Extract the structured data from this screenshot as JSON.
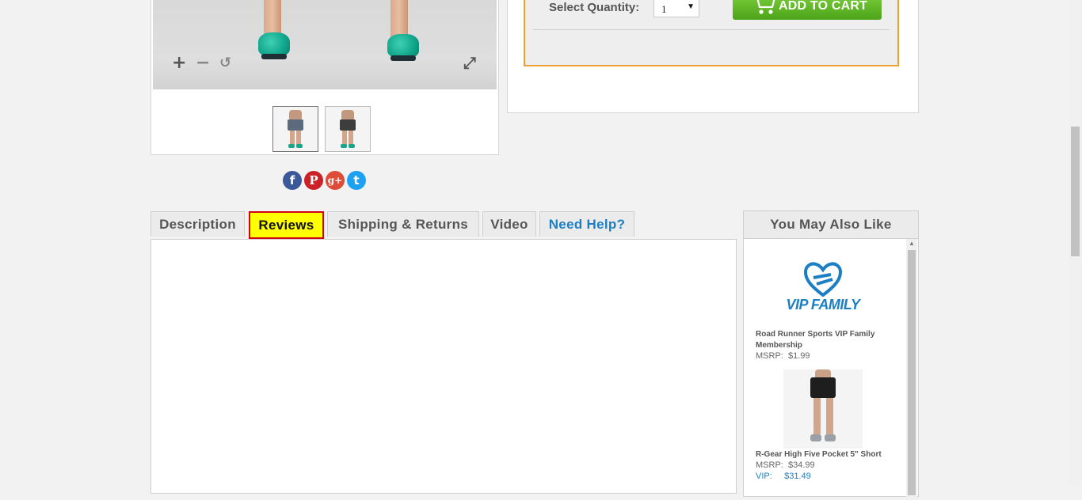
{
  "product_image": {
    "zoom_in_icon": "+",
    "zoom_out_icon": "−",
    "reset_icon": "↺",
    "fullscreen_icon": "⤢"
  },
  "purchase": {
    "quantity_label": "Select Quantity:",
    "quantity_value": "1",
    "dropdown_arrow": "▼",
    "add_to_cart_label": "ADD TO CART"
  },
  "social": [
    {
      "name": "facebook",
      "glyph": "f",
      "color": "#3b5998"
    },
    {
      "name": "pinterest",
      "glyph": "P",
      "color": "#cb2027"
    },
    {
      "name": "google-plus",
      "glyph": "g+",
      "color": "#dd4b39"
    },
    {
      "name": "twitter",
      "glyph": "t",
      "color": "#1da1f2"
    }
  ],
  "tabs": [
    {
      "label": "Description"
    },
    {
      "label": "Reviews",
      "active": true
    },
    {
      "label": "Shipping & Returns"
    },
    {
      "label": "Video"
    },
    {
      "label": "Need Help?"
    }
  ],
  "ymal": {
    "title": "You May Also Like",
    "vip_logo_text": "VIP FAMILY",
    "items": [
      {
        "name": "Road Runner Sports VIP Family Membership",
        "msrp_label": "MSRP:",
        "msrp": "$1.99"
      },
      {
        "name": "R-Gear High Five Pocket 5\" Short",
        "msrp_label": "MSRP:",
        "msrp": "$34.99",
        "vip_label": "VIP:",
        "vip": "$31.49"
      }
    ]
  },
  "colors": {
    "accent_orange": "#f0a030",
    "cart_green": "#5cb827",
    "reviews_highlight": "#ffff00",
    "reviews_border": "#d0021b",
    "link_blue": "#1b7fc4"
  }
}
